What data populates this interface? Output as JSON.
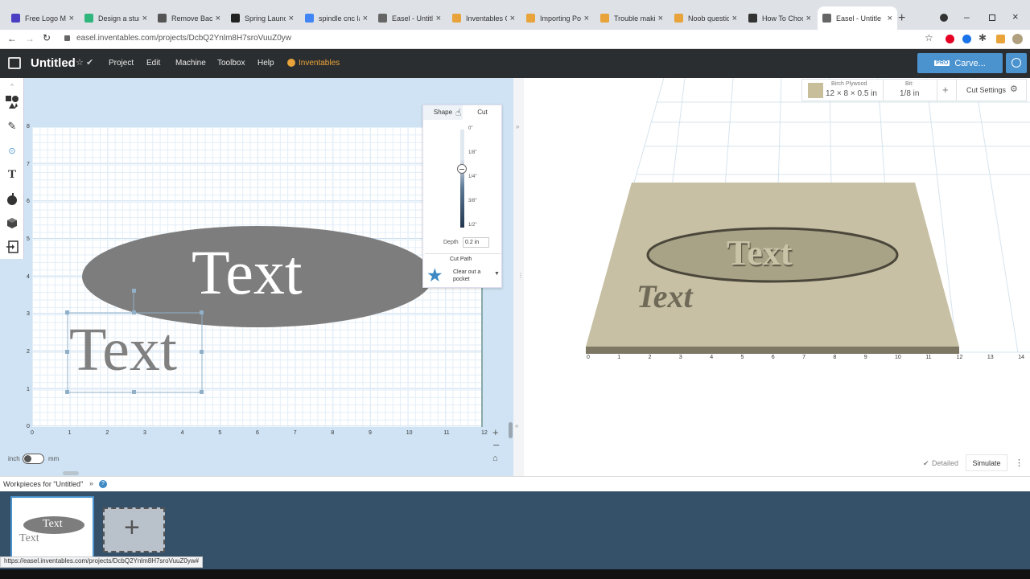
{
  "browser": {
    "tabs": [
      {
        "title": "Free Logo Ma",
        "color": "#4a3fc2"
      },
      {
        "title": "Design a stun",
        "color": "#2eb67d"
      },
      {
        "title": "Remove Back",
        "color": "#555"
      },
      {
        "title": "Spring Launch",
        "color": "#222"
      },
      {
        "title": "spindle cnc la",
        "color": "#4285f4"
      },
      {
        "title": "Easel - Untitle",
        "color": "#666"
      },
      {
        "title": "Inventables C",
        "color": "#e8a33a"
      },
      {
        "title": "Importing Po",
        "color": "#e8a33a"
      },
      {
        "title": "Trouble makin",
        "color": "#e8a33a"
      },
      {
        "title": "Noob questio",
        "color": "#e8a33a"
      },
      {
        "title": "How To Choo",
        "color": "#333"
      },
      {
        "title": "Easel - Untitle",
        "color": "#666"
      }
    ],
    "url": "easel.inventables.com/projects/DcbQ2Ynlm8H7sroVuuZ0yw",
    "status_url": "https://easel.inventables.com/projects/DcbQ2Ynlm8H7sroVuuZ0yw#"
  },
  "app": {
    "title": "Untitled",
    "menu": [
      "Project",
      "Edit",
      "Machine",
      "Toolbox",
      "Help"
    ],
    "inventables": "Inventables",
    "pro": "PRO",
    "carve": "Carve..."
  },
  "canvas": {
    "x_ticks": [
      "0",
      "1",
      "2",
      "3",
      "4",
      "5",
      "6",
      "7",
      "8",
      "9",
      "10",
      "11",
      "12"
    ],
    "y_ticks": [
      "8",
      "7",
      "6",
      "5",
      "4",
      "3",
      "2",
      "1",
      "0"
    ],
    "ellipse_text": "Text",
    "small_text": "Text",
    "unit_inch": "inch",
    "unit_mm": "mm"
  },
  "popup": {
    "tab_shape": "Shape",
    "tab_cut": "Cut",
    "depth_labels": [
      "0\"",
      "1/8\"",
      "1/4\"",
      "3/8\"",
      "1/2\""
    ],
    "depth_label": "Depth",
    "depth_value": "0.2 in",
    "cut_path": "Cut Path",
    "cut_option": "Clear out a pocket"
  },
  "material": {
    "name": "Birch Plywood",
    "size": "12 × 8 × 0.5 in",
    "bit_label": "Bit:",
    "bit_value": "1/8 in",
    "cut_settings": "Cut Settings",
    "color": "#c8bf9a"
  },
  "preview": {
    "x_ticks": [
      "0",
      "1",
      "2",
      "3",
      "4",
      "5",
      "6",
      "7",
      "8",
      "9",
      "10",
      "11",
      "12",
      "13",
      "14"
    ],
    "board_text_large": "Text",
    "board_text_small": "Text",
    "detailed": "Detailed",
    "simulate": "Simulate"
  },
  "workpieces": {
    "label": "Workpieces for \"Untitled\"",
    "thumb_text_1": "Text",
    "thumb_text_2": "Text"
  }
}
